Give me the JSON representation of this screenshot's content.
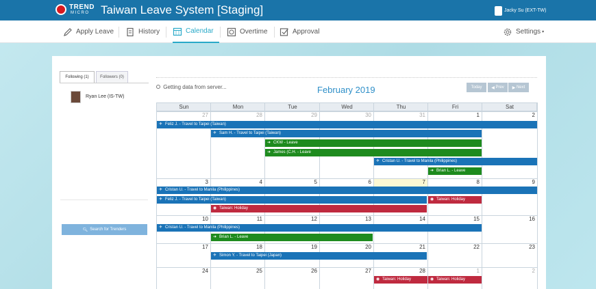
{
  "header": {
    "logo_text": "TREND",
    "logo_sub": "MICRO",
    "title": "Taiwan Leave System [Staging]",
    "user_name": "Jacky Su (EXT-TW)"
  },
  "nav": {
    "apply_leave": "Apply Leave",
    "history": "History",
    "calendar": "Calendar",
    "overtime": "Overtime",
    "approval": "Approval",
    "settings": "Settings"
  },
  "left_panel": {
    "tab_following": "Following (1)",
    "tab_followers": "Followers (0)",
    "followed_user": "Ryan Lee (IS-TW)",
    "search_button": "Search for Trenders"
  },
  "calendar": {
    "loading_text": "Getting data from server...",
    "month_title": "February 2019",
    "btn_today": "Today",
    "btn_prev": "Prev",
    "btn_next": "Next",
    "weekdays": [
      "Sun",
      "Mon",
      "Tue",
      "Wed",
      "Thu",
      "Fri",
      "Sat"
    ],
    "weeks": [
      [
        "27",
        "28",
        "29",
        "30",
        "31",
        "1",
        "2"
      ],
      [
        "3",
        "4",
        "5",
        "6",
        "7",
        "8",
        "9"
      ],
      [
        "10",
        "11",
        "12",
        "13",
        "14",
        "15",
        "16"
      ],
      [
        "17",
        "18",
        "19",
        "20",
        "21",
        "22",
        "23"
      ],
      [
        "24",
        "25",
        "26",
        "27",
        "28",
        "1",
        "2"
      ]
    ],
    "events": [
      {
        "label": "Feliz J. - Travel to Taipei (Taiwan)"
      },
      {
        "label": "Sam H. - Travel to Taipei (Taiwan)"
      },
      {
        "label": "CKW - Leave"
      },
      {
        "label": "James (C.H. - Leave"
      },
      {
        "label": "Cristan U. - Travel to Manila (Philippines)"
      },
      {
        "label": "Brian L. - Leave"
      },
      {
        "label": "Cristan U. - Travel to Manila (Philippines)"
      },
      {
        "label": "Feliz J. - Travel to Taipei (Taiwan)"
      },
      {
        "label": "Taiwan: Holiday"
      },
      {
        "label": "Taiwan: Holiday"
      },
      {
        "label": "Cristan U. - Travel to Manila (Philippines)"
      },
      {
        "label": "Brian L. - Leave"
      },
      {
        "label": "Simon Y. - Travel to Taipei (Japan)"
      },
      {
        "label": "Taiwan: Holiday"
      },
      {
        "label": "Taiwan: Holiday"
      }
    ]
  },
  "colors": {
    "header_bg": "#1a74a9",
    "accent": "#28a9c8",
    "event_blue": "#1a73b7",
    "event_green": "#1e8b1e",
    "event_red": "#bf2a3f",
    "today_bg": "#fcf8d4"
  }
}
